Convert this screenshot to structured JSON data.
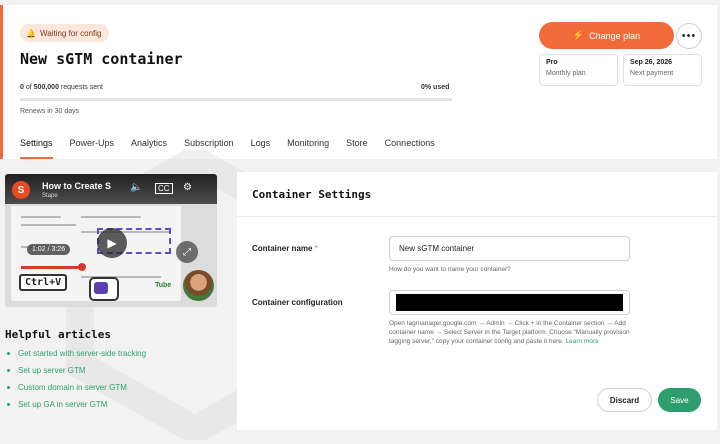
{
  "header": {
    "status_badge": "Waiting for config",
    "title": "New sGTM container",
    "usage": {
      "used": "0",
      "of_text": "of",
      "limit": "500,000",
      "suffix": "requests sent",
      "percent_label": "0% used",
      "percent": 0
    },
    "renews": "Renews in 30 days",
    "change_plan_label": "Change plan",
    "more_icon": "more-horizontal-icon",
    "plan": {
      "value": "Pro",
      "label": "Monthly plan"
    },
    "next_payment": {
      "value": "Sep 26, 2026",
      "label": "Next payment"
    }
  },
  "tabs": [
    {
      "label": "Settings",
      "active": true
    },
    {
      "label": "Power-Ups"
    },
    {
      "label": "Analytics"
    },
    {
      "label": "Subscription"
    },
    {
      "label": "Logs"
    },
    {
      "label": "Monitoring"
    },
    {
      "label": "Store"
    },
    {
      "label": "Connections"
    }
  ],
  "video": {
    "title": "How to Create S",
    "channel": "Stape",
    "time": "1:02 / 3:26",
    "overlay_text": "Ctrl+V",
    "icons": [
      "volume-icon",
      "captions-icon",
      "settings-icon",
      "play-icon",
      "expand-icon"
    ]
  },
  "helpful": {
    "title": "Helpful articles",
    "articles": [
      "Get started with server-side tracking",
      "Set up server GTM",
      "Custom domain in server GTM",
      "Set up GA in server GTM"
    ]
  },
  "settings": {
    "title": "Container Settings",
    "name_label": "Container name",
    "required_mark": "*",
    "name_value": "New sGTM container",
    "name_hint": "How do you want to name your container?",
    "config_label": "Container configuration",
    "config_hint": "Open tagmanager.google.com → Admin → Click + in the Container section → Add container name → Select Server in the Target platform. Choose \"Manually provision tagging server,\" copy your container config and paste it here.",
    "learn_more": "Learn more",
    "discard_label": "Discard",
    "save_label": "Save"
  },
  "colors": {
    "accent": "#f06a3a",
    "green": "#2f9e6e"
  }
}
